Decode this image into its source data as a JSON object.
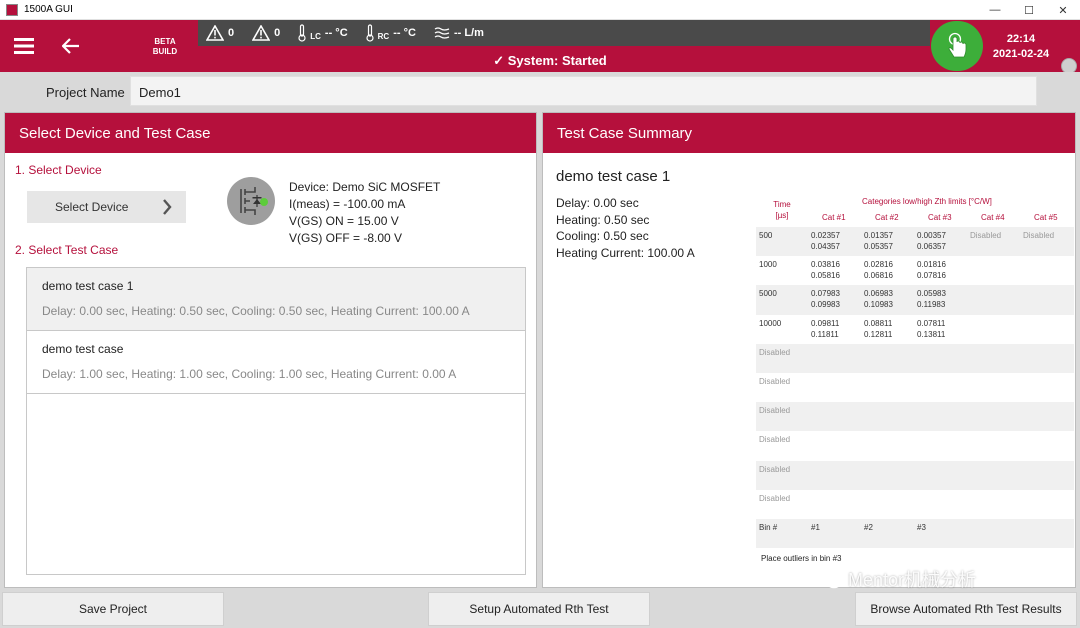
{
  "window": {
    "title": "1500A GUI",
    "controls": [
      "—",
      "☐",
      "✕"
    ]
  },
  "header": {
    "beta_line1": "BETA",
    "beta_line2": "BUILD",
    "warning1_count": "0",
    "warning2_count": "0",
    "lc_sub": "LC",
    "lc_value": "-- °C",
    "rc_sub": "RC",
    "rc_value": "-- °C",
    "flow_value": "-- L/m",
    "status": "✓ System: Started",
    "time": "22:14",
    "date": "2021-02-24",
    "accent_color": "#b5103c",
    "power_color": "#3dae3a"
  },
  "project": {
    "label": "Project Name",
    "value": "Demo1"
  },
  "left_panel": {
    "title": "Select Device and Test Case",
    "step1": "1. Select Device",
    "select_device_label": "Select Device",
    "device_info": {
      "device": "Device: Demo SiC MOSFET",
      "imeas": "I(meas) = -100.00 mA",
      "vgs_on": "V(GS) ON = 15.00 V",
      "vgs_off": "V(GS) OFF = -8.00 V"
    },
    "step2": "2. Select Test Case",
    "test_cases": [
      {
        "name": "demo test case 1",
        "desc": "Delay: 0.00 sec, Heating: 0.50 sec, Cooling: 0.50 sec, Heating Current: 100.00 A"
      },
      {
        "name": "demo test case",
        "desc": "Delay: 1.00 sec, Heating: 1.00 sec, Cooling: 1.00 sec, Heating Current: 0.00 A"
      }
    ]
  },
  "right_panel": {
    "title": "Test Case Summary",
    "case_name": "demo test case 1",
    "delay": "Delay: 0.00 sec",
    "heating": "Heating: 0.50 sec",
    "cooling": "Cooling: 0.50 sec",
    "current": "Heating Current: 100.00 A",
    "table": {
      "time_header1": "Time",
      "time_header2": "[µs]",
      "group_header": "Categories low/high Zth limits [°C/W]",
      "cat_headers": [
        "Cat #1",
        "Cat #2",
        "Cat #3",
        "Cat #4",
        "Cat #5"
      ],
      "rows": [
        {
          "time": "500",
          "c1": [
            "0.02357",
            "0.04357"
          ],
          "c2": [
            "0.01357",
            "0.05357"
          ],
          "c3": [
            "0.00357",
            "0.06357"
          ],
          "c4": "Disabled",
          "c5": "Disabled"
        },
        {
          "time": "1000",
          "c1": [
            "0.03816",
            "0.05816"
          ],
          "c2": [
            "0.02816",
            "0.06816"
          ],
          "c3": [
            "0.01816",
            "0.07816"
          ]
        },
        {
          "time": "5000",
          "c1": [
            "0.07983",
            "0.09983"
          ],
          "c2": [
            "0.06983",
            "0.10983"
          ],
          "c3": [
            "0.05983",
            "0.11983"
          ]
        },
        {
          "time": "10000",
          "c1": [
            "0.09811",
            "0.11811"
          ],
          "c2": [
            "0.08811",
            "0.12811"
          ],
          "c3": [
            "0.07811",
            "0.13811"
          ]
        }
      ],
      "disabled_rows": [
        "Disabled",
        "Disabled",
        "Disabled",
        "Disabled",
        "Disabled",
        "Disabled"
      ],
      "bin_label": "Bin #",
      "bins": [
        "#1",
        "#2",
        "#3"
      ],
      "outliers": "Place outliers in bin #3"
    }
  },
  "bottom": {
    "save": "Save Project",
    "setup": "Setup Automated Rth Test",
    "browse": "Browse Automated Rth Test Results"
  },
  "watermark": "Mentor机械分析"
}
